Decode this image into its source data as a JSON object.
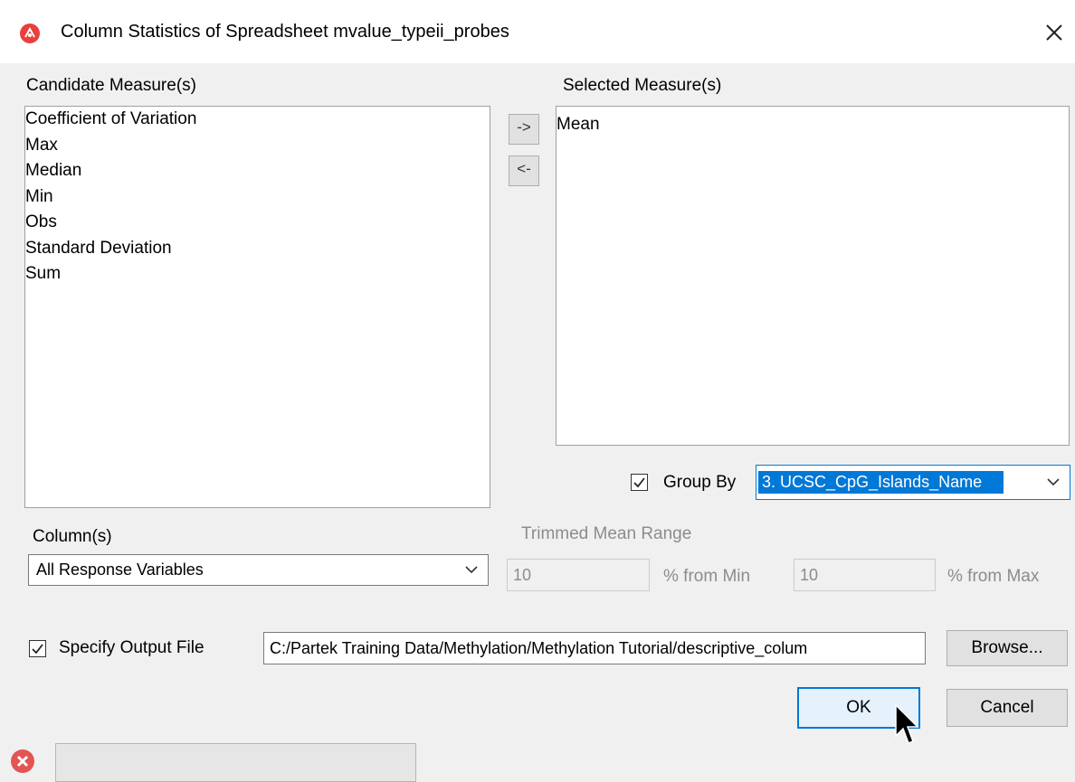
{
  "window": {
    "title": "Column Statistics of Spreadsheet mvalue_typeii_probes",
    "close_icon": "close-icon",
    "app_icon": "partek-app-icon"
  },
  "candidate": {
    "label": "Candidate Measure(s)",
    "items": [
      "Coefficient of Variation",
      "Max",
      "Median",
      "Min",
      "Obs",
      "Standard Deviation",
      "Sum"
    ]
  },
  "transfer": {
    "add_label": "->",
    "remove_label": "<-"
  },
  "selected": {
    "label": "Selected Measure(s)",
    "items": [
      "Mean"
    ]
  },
  "group_by": {
    "label": "Group By",
    "checked": true,
    "value": "3. UCSC_CpG_Islands_Name"
  },
  "columns": {
    "label": "Column(s)",
    "value": "All Response Variables"
  },
  "trimmed": {
    "label": "Trimmed Mean Range",
    "min_value": "10",
    "min_suffix": "% from Min",
    "max_value": "10",
    "max_suffix": "% from Max"
  },
  "output": {
    "label": "Specify Output File",
    "checked": true,
    "path": "C:/Partek Training Data/Methylation/Methylation Tutorial/descriptive_colum",
    "browse_label": "Browse..."
  },
  "buttons": {
    "ok_label": "OK",
    "cancel_label": "Cancel"
  },
  "colors": {
    "accent": "#0078d7",
    "selection": "#0078d7",
    "error_icon": "#e35454"
  }
}
